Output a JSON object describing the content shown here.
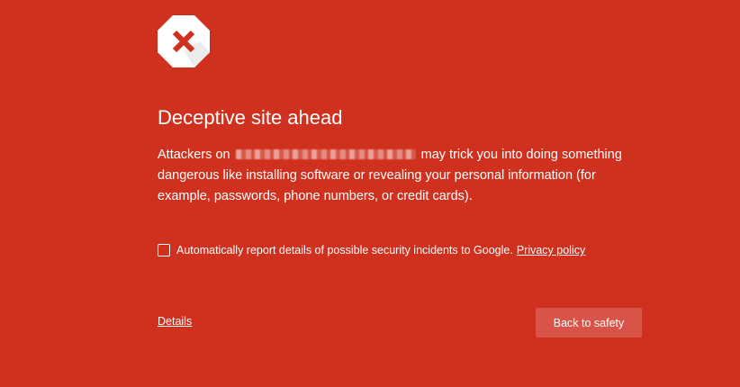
{
  "icons": {
    "stop": "stop-x-icon",
    "checkbox": "checkbox-unchecked-icon"
  },
  "colors": {
    "background": "#d0301e",
    "text": "#ffffff",
    "button": "#d95448",
    "icon_x": "#d0301e"
  },
  "interstitial": {
    "title": "Deceptive site ahead",
    "message_before": "Attackers on",
    "message_after": "may trick you into doing something dangerous like installing software or revealing your personal information (for example, passwords, phone numbers, or credit cards).",
    "report_label": "Automatically report details of possible security incidents to Google.",
    "report_checked": false,
    "privacy_link": "Privacy policy",
    "details_link": "Details",
    "back_button": "Back to safety"
  }
}
